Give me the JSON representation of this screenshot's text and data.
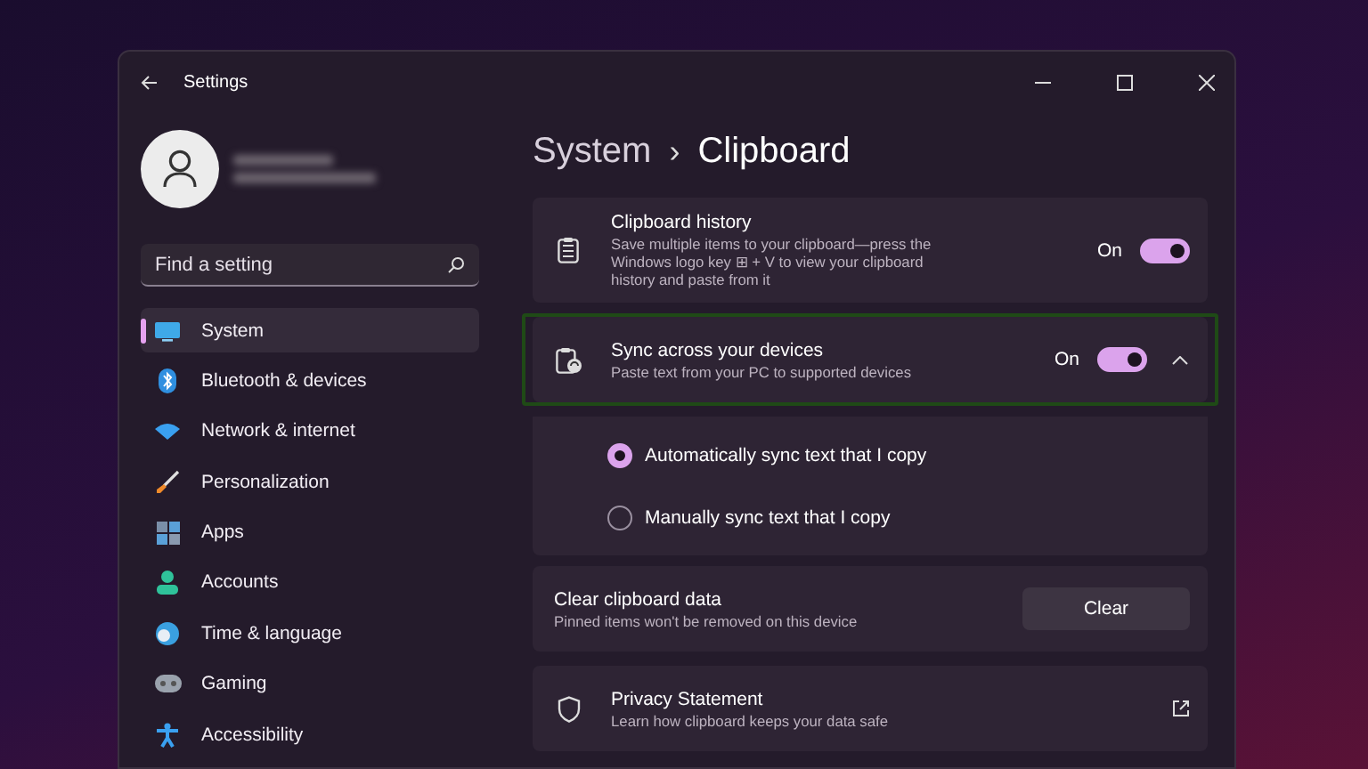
{
  "window": {
    "title": "Settings"
  },
  "search": {
    "placeholder": "Find a setting"
  },
  "nav": [
    {
      "label": "System",
      "selected": true
    },
    {
      "label": "Bluetooth & devices",
      "selected": false
    },
    {
      "label": "Network & internet",
      "selected": false
    },
    {
      "label": "Personalization",
      "selected": false
    },
    {
      "label": "Apps",
      "selected": false
    },
    {
      "label": "Accounts",
      "selected": false
    },
    {
      "label": "Time & language",
      "selected": false
    },
    {
      "label": "Gaming",
      "selected": false
    },
    {
      "label": "Accessibility",
      "selected": false
    }
  ],
  "breadcrumb": {
    "parent": "System",
    "separator": "›",
    "current": "Clipboard"
  },
  "settings": [
    {
      "kind": "toggle",
      "title": "Clipboard history",
      "description": "Save multiple items to your clipboard—press the Windows logo key ⊞ + V to view your clipboard history and paste from it",
      "state_label": "On",
      "on": true,
      "highlighted": false
    },
    {
      "kind": "toggle",
      "title": "Sync across your devices",
      "description": "Paste text from your PC to supported devices",
      "state_label": "On",
      "on": true,
      "highlighted": true,
      "expanded": true,
      "options": [
        {
          "label": "Automatically sync text that I copy",
          "selected": true
        },
        {
          "label": "Manually sync text that I copy",
          "selected": false
        }
      ]
    },
    {
      "kind": "button",
      "title": "Clear clipboard data",
      "description": "Pinned items won't be removed on this device",
      "button": "Clear",
      "highlighted": false
    },
    {
      "kind": "link",
      "title": "Privacy Statement",
      "description": "Learn how clipboard keeps your data safe",
      "highlighted": false
    }
  ]
}
